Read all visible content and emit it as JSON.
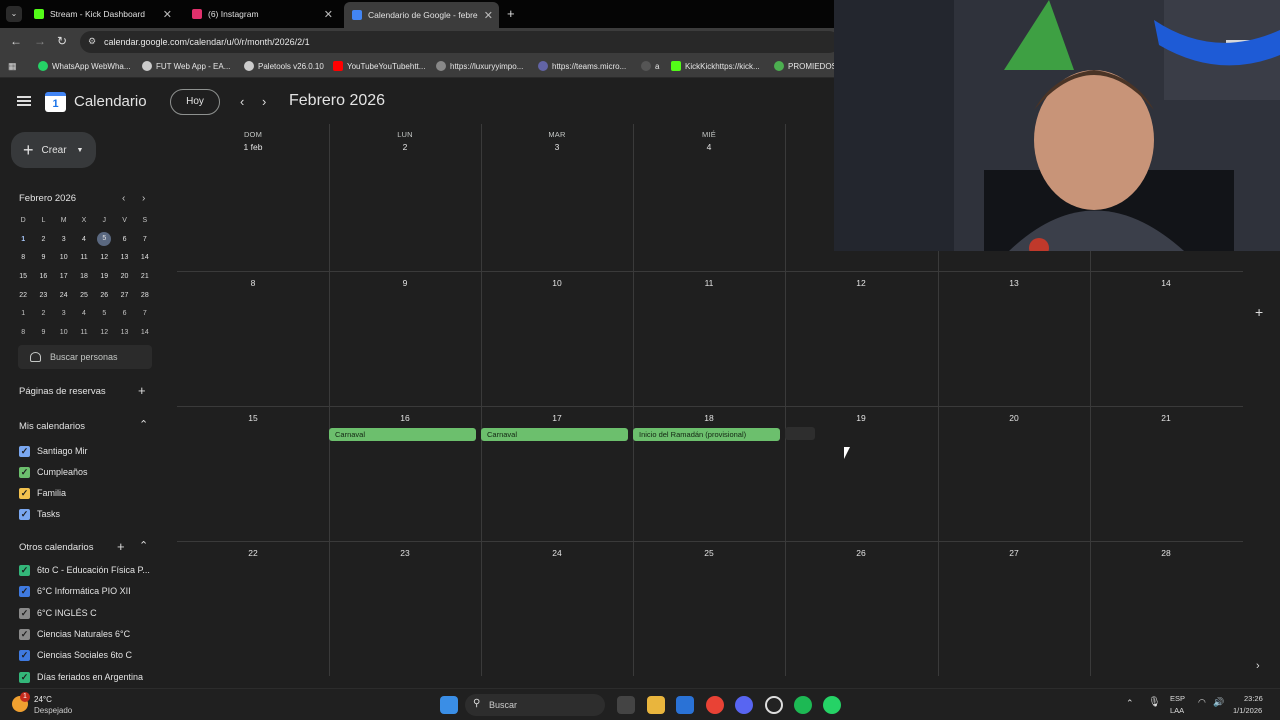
{
  "browser": {
    "tabs": [
      {
        "title": "Stream - Kick Dashboard",
        "icon": "kick-icon",
        "color": "#53fc18"
      },
      {
        "title": "(6) Instagram",
        "icon": "instagram-icon",
        "color": "#e1306c"
      },
      {
        "title": "Calendario de Google - febrero",
        "icon": "google-calendar-icon",
        "color": "#4285f4"
      }
    ],
    "url": "calendar.google.com/calendar/u/0/r/month/2026/2/1",
    "bookmarks": [
      {
        "label": "WhatsApp WebWha...",
        "color": "#25d366"
      },
      {
        "label": "FUT Web App - EA...",
        "color": "#cccccc"
      },
      {
        "label": "Paletools v26.0.10",
        "color": "#cccccc"
      },
      {
        "label": "YouTubeYouTubehtt...",
        "color": "#ff0000"
      },
      {
        "label": "https://luxuryyimpo...",
        "color": "#888888"
      },
      {
        "label": "https://teams.micro...",
        "color": "#6264a7"
      },
      {
        "label": "a",
        "color": "#555555"
      },
      {
        "label": "KickKickhttps://kick...",
        "color": "#53fc18"
      },
      {
        "label": "PROMIEDOS",
        "color": "#4caf50"
      }
    ]
  },
  "header": {
    "app_name": "Calendario",
    "logo_day": "1",
    "today_label": "Hoy",
    "month_title": "Febrero 2026"
  },
  "sidebar": {
    "create_label": "Crear",
    "mini_title": "Febrero 2026",
    "mini_dow": [
      "D",
      "L",
      "M",
      "X",
      "J",
      "V",
      "S"
    ],
    "mini_weeks": [
      [
        "1",
        "2",
        "3",
        "4",
        "5",
        "6",
        "7"
      ],
      [
        "8",
        "9",
        "10",
        "11",
        "12",
        "13",
        "14"
      ],
      [
        "15",
        "16",
        "17",
        "18",
        "19",
        "20",
        "21"
      ],
      [
        "22",
        "23",
        "24",
        "25",
        "26",
        "27",
        "28"
      ],
      [
        "1",
        "2",
        "3",
        "4",
        "5",
        "6",
        "7"
      ],
      [
        "8",
        "9",
        "10",
        "11",
        "12",
        "13",
        "14"
      ]
    ],
    "people_search": "Buscar personas",
    "booking_pages": "Páginas de reservas",
    "my_calendars_title": "Mis calendarios",
    "my_calendars": [
      {
        "label": "Santiago Mir",
        "color": "#7aa7f0"
      },
      {
        "label": "Cumpleaños",
        "color": "#6cbf6d"
      },
      {
        "label": "Familia",
        "color": "#f2c14e"
      },
      {
        "label": "Tasks",
        "color": "#7aa7f0"
      }
    ],
    "other_calendars_title": "Otros calendarios",
    "other_calendars": [
      {
        "label": "6to C - Educación Física P...",
        "color": "#33b679"
      },
      {
        "label": "6°C Informática PIO XII",
        "color": "#3f7ae0"
      },
      {
        "label": "6°C INGLÉS C",
        "color": "#8a8a8a"
      },
      {
        "label": "Ciencias Naturales 6°C",
        "color": "#8a8a8a"
      },
      {
        "label": "Ciencias Sociales 6to C",
        "color": "#3f7ae0"
      },
      {
        "label": "Días feriados en Argentina",
        "color": "#33b679"
      }
    ]
  },
  "month": {
    "weekday_labels": [
      "DOM",
      "LUN",
      "MAR",
      "MIÉ"
    ],
    "weeks": [
      [
        "1 feb",
        "2",
        "3",
        "4",
        "",
        "",
        ""
      ],
      [
        "8",
        "9",
        "10",
        "11",
        "12",
        "13",
        "14"
      ],
      [
        "15",
        "16",
        "17",
        "18",
        "19",
        "20",
        "21"
      ],
      [
        "22",
        "23",
        "24",
        "25",
        "26",
        "27",
        "28"
      ]
    ],
    "events": [
      {
        "title": "Carnaval",
        "color": "#6cbf6d"
      },
      {
        "title": "Carnaval",
        "color": "#6cbf6d"
      },
      {
        "title": "Inicio del Ramadán (provisional)",
        "color": "#6cbf6d"
      }
    ]
  },
  "taskbar": {
    "weather_temp": "24°C",
    "weather_desc": "Despejado",
    "search_placeholder": "Buscar",
    "lang_top": "ESP",
    "lang_bottom": "LAA",
    "time": "23:26",
    "date": "1/1/2026"
  }
}
